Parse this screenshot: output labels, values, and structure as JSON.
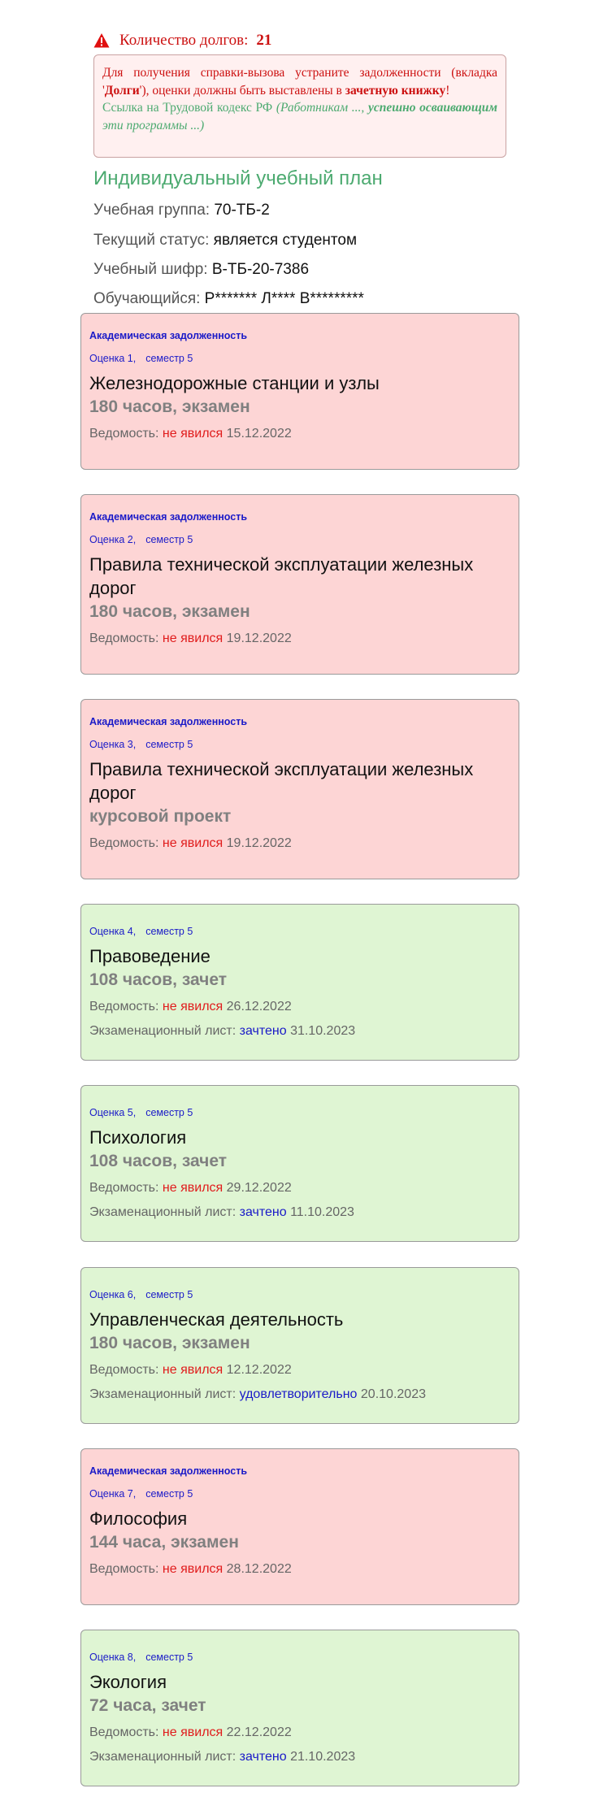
{
  "debts": {
    "label": "Количество долгов:",
    "count": "21",
    "icon": "warning-icon",
    "color": "#cc1111"
  },
  "notice": {
    "line1": "Для получения справки-вызова устраните задолженности (вкладка '",
    "tab": "Долги",
    "line2": "'), оценки должны быть выставлены в ",
    "book": "зачетную книжку",
    "line3": "!",
    "link_prefix": "Ссылка на Трудовой кодекс РФ",
    "link_italic1": "(Работникам ..., ",
    "link_bold": "успешно осваивающим",
    "link_italic2": " эти программы ...)"
  },
  "plan": {
    "title": "Индивидуальный учебный план",
    "group_label": "Учебная группа:",
    "group_value": "70-ТБ-2",
    "status_label": "Текущий статус:",
    "status_value": "является студентом",
    "cipher_label": "Учебный шифр:",
    "cipher_value": "В-ТБ-20-7386",
    "student_label": "Обучающийся:",
    "student_value": "Р******* Л**** В*********"
  },
  "colors": {
    "debt_bg": "#fdd5d5",
    "ok_bg": "#dff5d3",
    "accent_green": "#4caa70",
    "link_blue": "#1a1ac8",
    "absent_red": "#e01c1c"
  },
  "cards": [
    {
      "badge": "Академическая задолженность",
      "grade": "Оценка 1,",
      "semester": "семестр 5",
      "subject": "Железнодорожные станции и узлы",
      "hours": "180 часов, экзамен",
      "sheet_label": "Ведомость:",
      "sheet_result": "не явился",
      "sheet_date": "15.12.2022"
    },
    {
      "badge": "Академическая задолженность",
      "grade": "Оценка 2,",
      "semester": "семестр 5",
      "subject": "Правила технической эксплуатации железных дорог",
      "hours": "180 часов, экзамен",
      "sheet_label": "Ведомость:",
      "sheet_result": "не явился",
      "sheet_date": "19.12.2022"
    },
    {
      "badge": "Академическая задолженность",
      "grade": "Оценка 3,",
      "semester": "семестр 5",
      "subject": "Правила технической эксплуатации железных дорог",
      "hours": "курсовой проект",
      "sheet_label": "Ведомость:",
      "sheet_result": "не явился",
      "sheet_date": "19.12.2022"
    },
    {
      "grade": "Оценка 4,",
      "semester": "семестр 5",
      "subject": "Правоведение",
      "hours": "108 часов, зачет",
      "sheet_label": "Ведомость:",
      "sheet_result": "не явился",
      "sheet_date": "26.12.2022",
      "exam_label": "Экзаменационный лист:",
      "exam_result": "зачтено",
      "exam_date": "31.10.2023"
    },
    {
      "grade": "Оценка 5,",
      "semester": "семестр 5",
      "subject": "Психология",
      "hours": "108 часов, зачет",
      "sheet_label": "Ведомость:",
      "sheet_result": "не явился",
      "sheet_date": "29.12.2022",
      "exam_label": "Экзаменационный лист:",
      "exam_result": "зачтено",
      "exam_date": "11.10.2023"
    },
    {
      "grade": "Оценка 6,",
      "semester": "семестр 5",
      "subject": "Управленческая деятельность",
      "hours": "180 часов, экзамен",
      "sheet_label": "Ведомость:",
      "sheet_result": "не явился",
      "sheet_date": "12.12.2022",
      "exam_label": "Экзаменационный лист:",
      "exam_result": "удовлетворительно",
      "exam_date": "20.10.2023"
    },
    {
      "badge": "Академическая задолженность",
      "grade": "Оценка 7,",
      "semester": "семестр 5",
      "subject": "Философия",
      "hours": "144 часа, экзамен",
      "sheet_label": "Ведомость:",
      "sheet_result": "не явился",
      "sheet_date": "28.12.2022"
    },
    {
      "grade": "Оценка 8,",
      "semester": "семестр 5",
      "subject": "Экология",
      "hours": "72 часа, зачет",
      "sheet_label": "Ведомость:",
      "sheet_result": "не явился",
      "sheet_date": "22.12.2022",
      "exam_label": "Экзаменационный лист:",
      "exam_result": "зачтено",
      "exam_date": "21.10.2023"
    }
  ]
}
